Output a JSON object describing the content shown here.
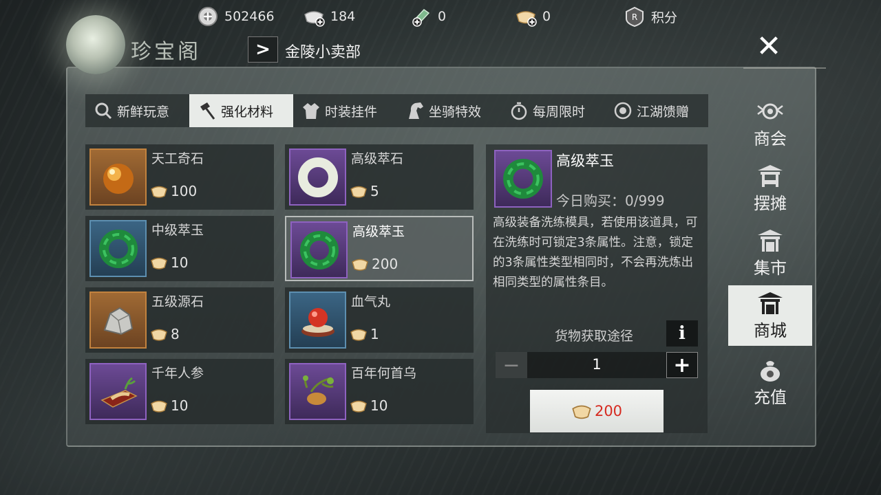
{
  "currencies": [
    {
      "name": "coin-icon",
      "value": "502466"
    },
    {
      "name": "silver-plus-icon",
      "value": "184"
    },
    {
      "name": "jade-plus-icon",
      "value": "0"
    },
    {
      "name": "ingot-plus-icon",
      "value": "0"
    },
    {
      "name": "points-icon",
      "value": "积分"
    }
  ],
  "header": {
    "title": "珍宝阁",
    "subtitle": "金陵小卖部",
    "arrow": ">",
    "close": "✕"
  },
  "tabs": [
    {
      "label": "新鲜玩意",
      "icon": "magnifier-icon",
      "active": false
    },
    {
      "label": "强化材料",
      "icon": "hammer-icon",
      "active": true
    },
    {
      "label": "时装挂件",
      "icon": "robe-icon",
      "active": false
    },
    {
      "label": "坐骑特效",
      "icon": "horse-icon",
      "active": false
    },
    {
      "label": "每周限时",
      "icon": "stopwatch-icon",
      "active": false
    },
    {
      "label": "江湖馈赠",
      "icon": "coin-ring-icon",
      "active": false
    }
  ],
  "items": [
    {
      "name": "天工奇石",
      "price": "100",
      "frame": "orange",
      "icon": "orb-icon"
    },
    {
      "name": "高级萃石",
      "price": "5",
      "frame": "purple",
      "icon": "white-ring-icon"
    },
    {
      "name": "中级萃玉",
      "price": "10",
      "frame": "blue",
      "icon": "green-ring-icon"
    },
    {
      "name": "高级萃玉",
      "price": "200",
      "frame": "purple",
      "icon": "green-ring-icon"
    },
    {
      "name": "五级源石",
      "price": "8",
      "frame": "orange",
      "icon": "rock-icon"
    },
    {
      "name": "血气丸",
      "price": "1",
      "frame": "blue",
      "icon": "pill-icon"
    },
    {
      "name": "千年人参",
      "price": "10",
      "frame": "purple",
      "icon": "ginseng-icon"
    },
    {
      "name": "百年何首乌",
      "price": "10",
      "frame": "purple",
      "icon": "root-icon"
    }
  ],
  "detail": {
    "name": "高级萃玉",
    "count_label": "今日购买：0/999",
    "description": "高级装备洗练模具，若使用该道具，可在洗练时可锁定3条属性。注意，锁定的3条属性类型相同时，不会再洗炼出相同类型的属性条目。",
    "source_label": "货物获取途径",
    "info": "i",
    "quantity": "1",
    "minus": "−",
    "plus": "+",
    "total_price": "200",
    "price_color": "#d62a20"
  },
  "nav": [
    {
      "label": "商会",
      "icon": "chamber-icon",
      "active": false
    },
    {
      "label": "摆摊",
      "icon": "stall-icon",
      "active": false
    },
    {
      "label": "集市",
      "icon": "market-icon",
      "active": false
    },
    {
      "label": "商城",
      "icon": "mall-icon",
      "active": true
    },
    {
      "label": "充值",
      "icon": "money-bag-icon",
      "active": false
    }
  ]
}
